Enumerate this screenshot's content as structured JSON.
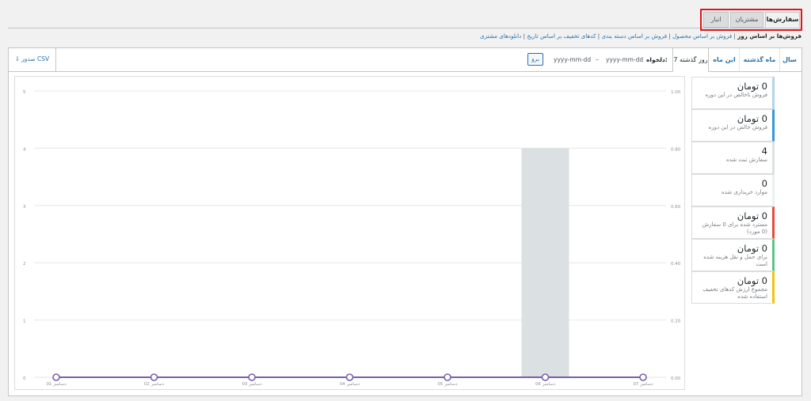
{
  "nav": {
    "tabs": [
      {
        "label": "سفارش‌ها",
        "active": true
      },
      {
        "label": "مشتریان",
        "active": false
      },
      {
        "label": "انبار",
        "active": false
      }
    ]
  },
  "subnav": {
    "items": [
      {
        "label": "فروش‌ها بر اساس روز",
        "current": true
      },
      {
        "label": "فروش بر اساس محصول",
        "current": false
      },
      {
        "label": "فروش بر اساس دسته بندی",
        "current": false
      },
      {
        "label": "کدهای تخفیف بر اساس تاریخ",
        "current": false
      },
      {
        "label": "دانلودهای مشتری",
        "current": false
      }
    ]
  },
  "range": {
    "year": "سال",
    "last_month": "ماه گذشته",
    "this_month": "این ماه",
    "last_7_days": "7 روز گذشته",
    "custom_label": "دلخواه:",
    "date_from_placeholder": "yyyy-mm-dd",
    "separator": "–",
    "date_to_placeholder": "yyyy-mm-dd",
    "go": "برو",
    "export": "صدور CSV",
    "export_icon": "download-icon"
  },
  "legend": [
    {
      "amount": "0 تومان",
      "label": "فروش ناخالص در این دوره",
      "color": "#b1d4ea"
    },
    {
      "amount": "0 تومان",
      "label": "فروش خالص در این دوره",
      "color": "#3498db"
    },
    {
      "amount": "4",
      "label": "سفارش ثبت شده",
      "color": "#dbe1e3"
    },
    {
      "amount": "0",
      "label": "موارد خریداری شده",
      "color": "#ecf0f1"
    },
    {
      "amount": "0 تومان",
      "label": "مسترد شده برای 0 سفارش (0 مورد)",
      "color": "#e74c3c"
    },
    {
      "amount": "0 تومان",
      "label": "برای حمل و نقل هزینه شده است",
      "color": "#5cc488"
    },
    {
      "amount": "0 تومان",
      "label": "مجموع ارزش کدهای تخفیف استفاده شده",
      "color": "#f1c40f"
    }
  ],
  "chart_data": {
    "type": "bar",
    "categories": [
      "01 دسامبر",
      "02 دسامبر",
      "03 دسامبر",
      "04 دسامبر",
      "05 دسامبر",
      "06 دسامبر",
      "07 دسامبر"
    ],
    "left_ticks": [
      "0",
      "1",
      "2",
      "3",
      "4",
      "5"
    ],
    "right_ticks": [
      "0.00",
      "0.20",
      "0.40",
      "0.60",
      "0.80",
      "1.00"
    ],
    "ylim": [
      0,
      5
    ],
    "series": [
      {
        "values": [
          0,
          0,
          0,
          0,
          0,
          4,
          0
        ],
        "color": "#dbe1e3"
      },
      {
        "values": [
          0,
          0,
          0,
          0,
          0,
          0,
          0
        ],
        "color": "#b1d4ea"
      },
      {
        "values": [
          0,
          0,
          0,
          0,
          0,
          0,
          0
        ],
        "color": "#e74c3c"
      },
      {
        "values": [
          0,
          0,
          0,
          0,
          0,
          0,
          0
        ],
        "color": "#3498db"
      }
    ],
    "grid": true
  }
}
